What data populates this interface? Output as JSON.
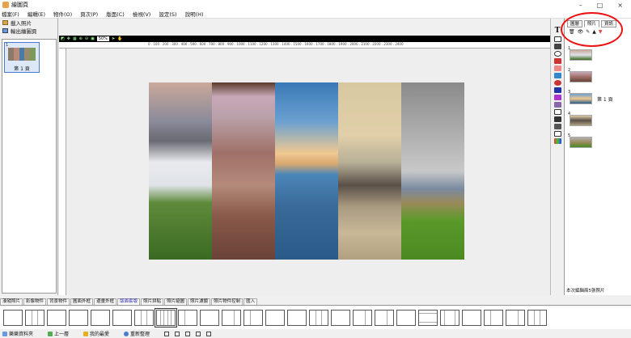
{
  "window": {
    "title": "繪圖頁",
    "controls": [
      "–",
      "□",
      "×"
    ]
  },
  "menu": [
    "檔案(F)",
    "編輯(E)",
    "物件(O)",
    "頁次(P)",
    "版面(C)",
    "檢視(V)",
    "設定(S)",
    "說明(H)"
  ],
  "left_panel": {
    "import_button": "載入照片",
    "export_button": "輸出繪圖頁",
    "page_number": "1",
    "page_label": "第 1 頁"
  },
  "toolbar": {
    "zoom": "50%"
  },
  "ruler_text": "0 . 100 . 200 . 300 . 400 . 500 . 600 . 700 . 800 . 900 . 1000 . 1100 . 1200 . 1300 . 1400 . 1500 . 1600 . 1700 . 1800 . 1900 . 2000 . 2100 . 2200 . 2300 . 2400",
  "right_tools": {
    "text_tool": "T"
  },
  "right_panel": {
    "tabs": [
      "圖層",
      "照片",
      "資訊"
    ],
    "active_tab": 1,
    "icons": [
      "🗑",
      "👁",
      "✎",
      "▲",
      "▼"
    ],
    "thumb_numbers": [
      "1",
      "2",
      "3",
      "4",
      "5"
    ],
    "page_label": "第 1 頁",
    "status": "本次編輯兩5張照片"
  },
  "bottom_tabs": [
    "湊隨照片",
    "影像物件",
    "背景物件",
    "圖面外框",
    "邊畫外框",
    "版面套版",
    "照片拼貼",
    "照片縮圖",
    "照片濾鏡",
    "照片物件控制",
    "匯入"
  ],
  "active_bottom_tab": 5,
  "statusbar": [
    "樂樂資料夾",
    "上一層",
    "我的最愛",
    "重新整理"
  ],
  "colors": {
    "accent": "#4a7ad0",
    "annotation": "#e11111",
    "toolbar": "#000000"
  }
}
